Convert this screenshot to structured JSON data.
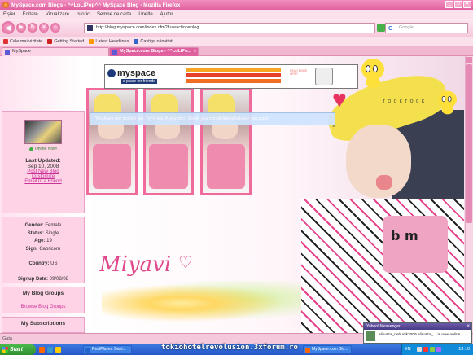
{
  "window": {
    "title": "MySpace.com Blogs - ^^LoLiPop^^ MySpace Blog - Mozilla Firefox",
    "controls": [
      "_",
      "□",
      "×"
    ]
  },
  "menu": [
    "Fișier",
    "Editare",
    "Vizualizare",
    "Istoric",
    "Semne de carte",
    "Unelte",
    "Ajutor"
  ],
  "address": {
    "url": "http://blog.myspace.com/index.cfm?fuseaction=blog",
    "search_placeholder": "Google"
  },
  "bookmarks": [
    "Cele mai vizitate",
    "Getting Started",
    "Latest Headlines",
    "Castiga o invitati..."
  ],
  "tabs": [
    {
      "label": "MySpace",
      "active": false
    },
    {
      "label": "MySpace.com Blogs - ^^LoLiPo...",
      "active": true
    }
  ],
  "banner": {
    "logo": "myspace",
    "tagline": "a place for friends",
    "promo": "READ MORE HERE"
  },
  "notice": "You have not posted yet. Try it out, if you don't like it, you can delete whatever you post!",
  "sidebar": {
    "online_label": "Online Now!",
    "last_updated_label": "Last Updated:",
    "last_updated_date": "Sep 10, 2008",
    "links": [
      "Post New Blog",
      "Customize",
      "Email to a Friend"
    ],
    "profile": [
      {
        "key": "Gender:",
        "value": "Female"
      },
      {
        "key": "Status:",
        "value": "Single"
      },
      {
        "key": "Age:",
        "value": "19"
      },
      {
        "key": "Sign:",
        "value": "Capricorn"
      },
      {
        "key": "Country:",
        "value": "US"
      },
      {
        "key": "Signup Date:",
        "value": "09/08/08"
      }
    ],
    "groups_heading": "My Blog Groups",
    "groups_link": "Browse Blog Groups",
    "subscriptions_heading": "My Subscriptions"
  },
  "artwork": {
    "name_text": "Miyavi",
    "shirt_text": "b m",
    "bubble_text": "T O C K T O C K"
  },
  "status_text": "Gata",
  "messenger": {
    "title": "Yahoo! Messenger",
    "message": "alinutza_nebunik2009 alinutza_... is now online"
  },
  "taskbar": {
    "start": "Start",
    "buttons": [
      "RealPlayer: Dani...",
      "MySpace.com Blo..."
    ],
    "language": "EN",
    "clock": "13:10"
  },
  "watermark": "tokiohotelrevolusion.3xforum.ro",
  "colors": {
    "chrome_pink": "#e0609f",
    "accent_link": "#cc3399",
    "panel_pink": "#ffd3e6",
    "taskbar_blue": "#2456c9"
  }
}
